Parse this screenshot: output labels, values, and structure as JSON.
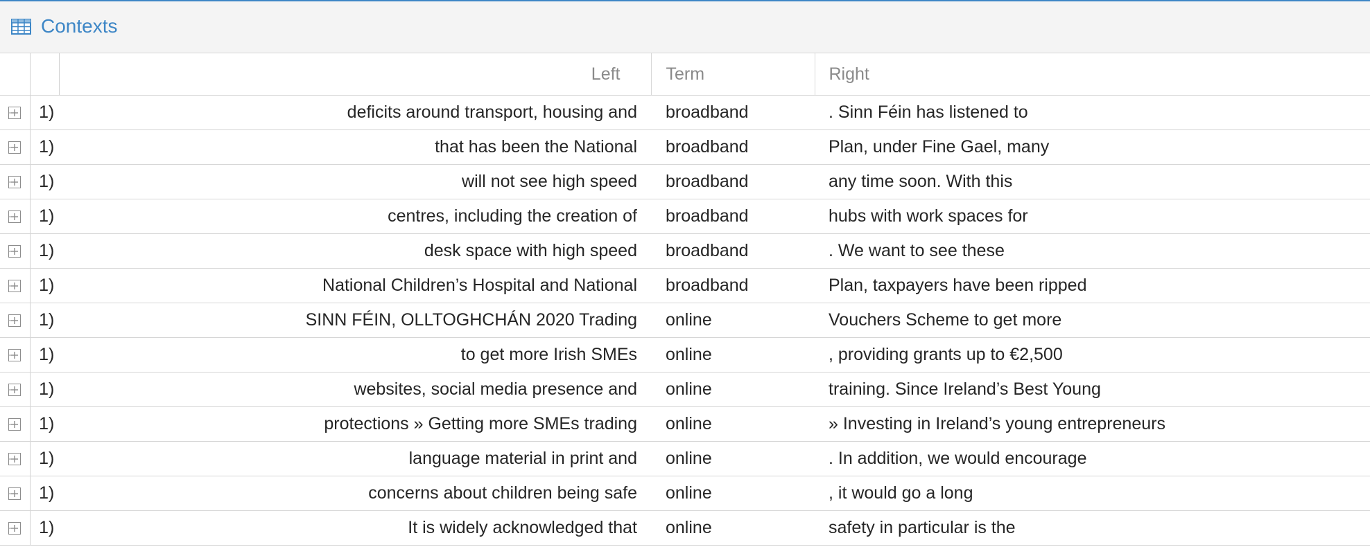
{
  "panel": {
    "title": "Contexts",
    "icon": "table-icon",
    "accent_color": "#3d86c6"
  },
  "columns": {
    "left": "Left",
    "term": "Term",
    "right": "Right"
  },
  "rows": [
    {
      "num": "1)",
      "left": "deficits around transport, housing and",
      "term": "broadband",
      "right": ". Sinn Féin has listened to"
    },
    {
      "num": "1)",
      "left": "that has been the National",
      "term": "broadband",
      "right": "Plan, under Fine Gael, many"
    },
    {
      "num": "1)",
      "left": "will not see high speed",
      "term": "broadband",
      "right": "any time soon. With this"
    },
    {
      "num": "1)",
      "left": "centres, including the creation of",
      "term": "broadband",
      "right": "hubs with work spaces for"
    },
    {
      "num": "1)",
      "left": "desk space with high speed",
      "term": "broadband",
      "right": ". We want to see these"
    },
    {
      "num": "1)",
      "left": "National Children’s Hospital and National",
      "term": "broadband",
      "right": "Plan, taxpayers have been ripped"
    },
    {
      "num": "1)",
      "left": "SINN FÉIN, OLLTOGHCHÁN 2020 Trading",
      "term": "online",
      "right": "Vouchers Scheme to get more"
    },
    {
      "num": "1)",
      "left": "to get more Irish SMEs",
      "term": "online",
      "right": ", providing grants up to €2,500"
    },
    {
      "num": "1)",
      "left": "websites, social media presence and",
      "term": "online",
      "right": "training. Since Ireland’s Best Young"
    },
    {
      "num": "1)",
      "left": "protections » Getting more SMEs trading",
      "term": "online",
      "right": "» Investing in Ireland’s young entrepreneurs"
    },
    {
      "num": "1)",
      "left": "language material in print and",
      "term": "online",
      "right": ". In addition, we would encourage"
    },
    {
      "num": "1)",
      "left": "concerns about children being safe",
      "term": "online",
      "right": ", it would go a long"
    },
    {
      "num": "1)",
      "left": "It is widely acknowledged that",
      "term": "online",
      "right": "safety in particular is the"
    }
  ]
}
